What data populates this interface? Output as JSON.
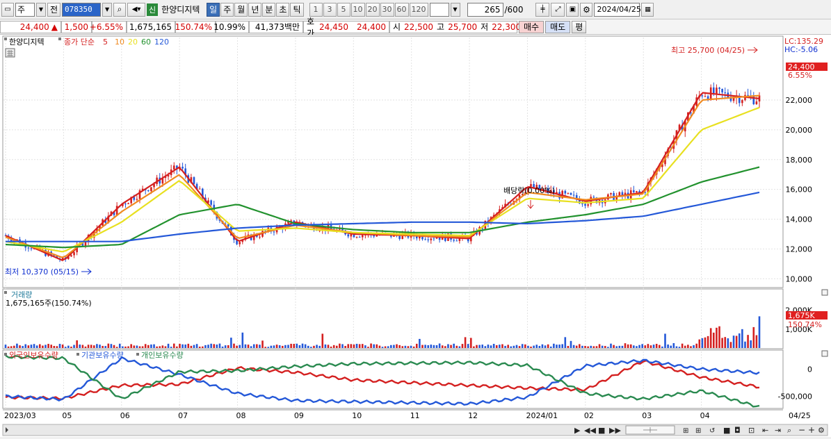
{
  "toolbar": {
    "market_select": "주",
    "prev_label": "전",
    "stock_code": "078350",
    "credit_badge": "신",
    "stock_name": "한양디지텍",
    "periods": [
      "일",
      "주",
      "월",
      "년",
      "분",
      "초",
      "틱"
    ],
    "active_period": "일",
    "intervals": [
      "1",
      "3",
      "5",
      "10",
      "20",
      "30",
      "60",
      "120"
    ],
    "count_value": "265",
    "count_total": "/600",
    "date_value": "2024/04/25"
  },
  "quote": {
    "price": "24,400",
    "change_arrow": "▲",
    "change": "1,500",
    "change_pct": "+6.55%",
    "volume": "1,675,165",
    "volume_ratio": "150.74%",
    "turnover": "10.99%",
    "amount": "41,373백만",
    "ask_label": "호가",
    "ask": "24,450",
    "bid": "24,400",
    "open_label": "시",
    "open": "22,500",
    "high_label": "고",
    "high": "25,700",
    "low_label": "저",
    "low": "22,300",
    "buy_label": "매수",
    "sell_label": "매도",
    "eval_label": "평"
  },
  "price_panel": {
    "legend_name": "한양디지텍",
    "legend_ma_label": "종가 단순",
    "ma_periods": [
      "5",
      "10",
      "20",
      "60",
      "120"
    ],
    "ma_colors": [
      "#d42020",
      "#f08a20",
      "#e8e020",
      "#22922e",
      "#2458d8"
    ],
    "lc_label": "LC:135.29",
    "hc_label": "HC:-5.06",
    "current_tag": "24,400",
    "current_pct": "6.55%",
    "high_annotation": "최고 25,700 (04/25)",
    "low_annotation": "최저 10,370 (05/15)",
    "dividend_annotation": "배당락(0.00%)"
  },
  "volume_panel": {
    "title": "거래량",
    "value_label": "1,675,165주(150.74%)",
    "current_tag": "1,675K",
    "current_pct": "150.74%"
  },
  "holdings_panel": {
    "series_labels": [
      "외국인보유수량",
      "기관보유수량",
      "개인보유수량"
    ],
    "series_colors": [
      "#d42020",
      "#2458d8",
      "#2a8a50"
    ]
  },
  "x_axis": {
    "ticks": [
      "2023/03",
      "05",
      "06",
      "07",
      "08",
      "09",
      "10",
      "11",
      "12",
      "2024/01",
      "02",
      "03",
      "04"
    ],
    "end_label": "04/25"
  },
  "chart_data": [
    {
      "type": "line",
      "title": "",
      "ylabel": "",
      "ylim": [
        9500,
        26200
      ],
      "yticks": [
        10000,
        12000,
        14000,
        16000,
        18000,
        20000,
        22000
      ],
      "x": [
        "2023/03",
        "05",
        "06",
        "07",
        "08",
        "09",
        "10",
        "11",
        "12",
        "2024/01",
        "02",
        "03",
        "04",
        "04/25"
      ],
      "series": [
        {
          "name": "5",
          "values": [
            12900,
            11200,
            15000,
            17500,
            12500,
            13800,
            13000,
            12900,
            12700,
            16200,
            15200,
            15800,
            22500,
            22100
          ]
        },
        {
          "name": "10",
          "values": [
            12800,
            11400,
            14500,
            17000,
            12700,
            13600,
            13100,
            12900,
            12800,
            15800,
            15300,
            15700,
            22000,
            22300
          ]
        },
        {
          "name": "20",
          "values": [
            12500,
            11800,
            13800,
            16600,
            13200,
            13400,
            13100,
            13000,
            12900,
            15400,
            15100,
            15400,
            20000,
            21500
          ]
        },
        {
          "name": "60",
          "values": [
            12300,
            12100,
            12300,
            14300,
            15000,
            13700,
            13300,
            13100,
            13100,
            13800,
            14300,
            15000,
            16500,
            17500
          ]
        },
        {
          "name": "120",
          "values": [
            12500,
            12500,
            12500,
            13000,
            13400,
            13600,
            13700,
            13800,
            13800,
            13700,
            13900,
            14200,
            15000,
            15800
          ]
        }
      ]
    },
    {
      "type": "bar",
      "title": "",
      "yticks": [
        1000000,
        2000000
      ],
      "current_value": 1675165
    },
    {
      "type": "line",
      "title": "",
      "yticks": [
        0,
        -500000
      ],
      "ylim": [
        -700000,
        300000
      ],
      "x": [
        "2023/03",
        "05",
        "06",
        "07",
        "08",
        "09",
        "10",
        "11",
        "12",
        "2024/01",
        "02",
        "03",
        "04",
        "04/25"
      ],
      "series": [
        {
          "name": "외국인보유수량",
          "values": [
            -520000,
            -540000,
            -300000,
            -280000,
            20000,
            -60000,
            -200000,
            -250000,
            -300000,
            -350000,
            -380000,
            150000,
            -150000,
            -330000
          ]
        },
        {
          "name": "기관보유수량",
          "values": [
            -500000,
            -560000,
            200000,
            -100000,
            -450000,
            -580000,
            -600000,
            -620000,
            -640000,
            -520000,
            60000,
            160000,
            0,
            -70000
          ]
        },
        {
          "name": "개인보유수량",
          "values": [
            230000,
            200000,
            -550000,
            -50000,
            -30000,
            50000,
            100000,
            110000,
            120000,
            70000,
            -450000,
            -550000,
            -400000,
            -700000
          ]
        }
      ]
    }
  ]
}
